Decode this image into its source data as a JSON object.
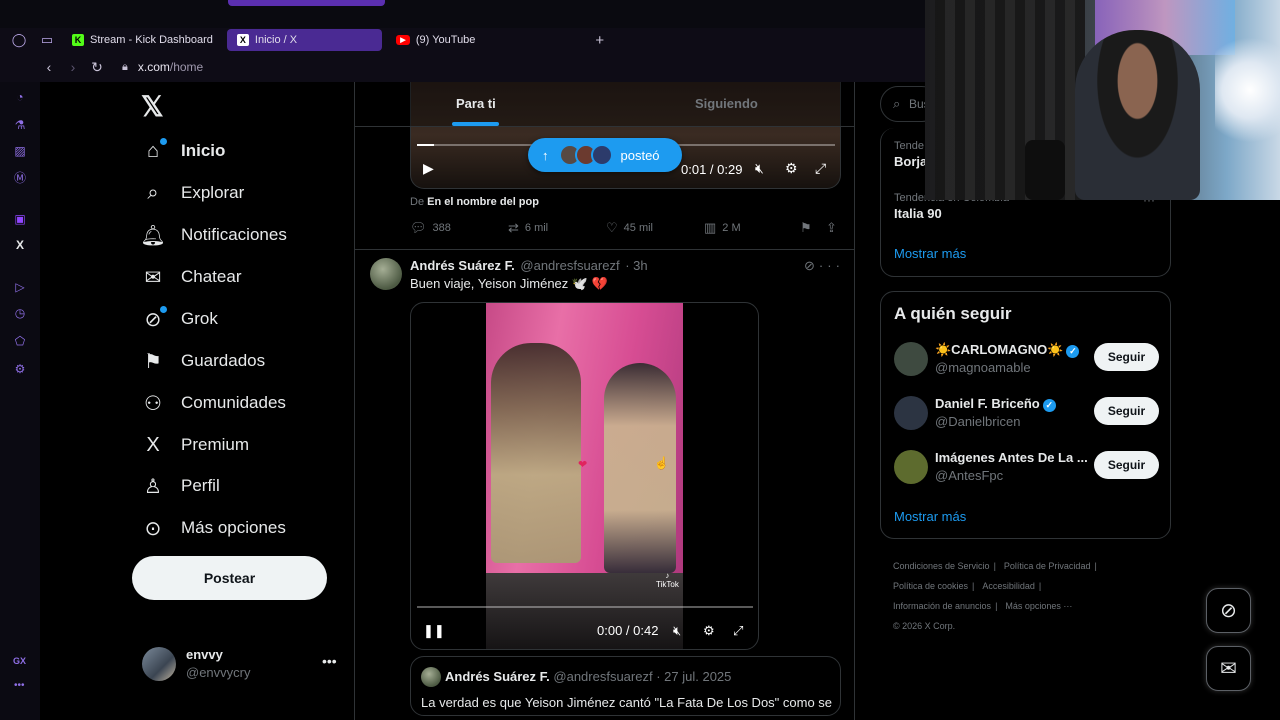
{
  "browser": {
    "tabs": [
      {
        "label": "Stream - Kick Dashboard",
        "icon": "kick-icon",
        "active": false
      },
      {
        "label": "Inicio / X",
        "icon": "x-icon",
        "active": true
      },
      {
        "label": "(9) YouTube",
        "icon": "youtube-icon",
        "active": false
      }
    ],
    "url_host": "x.com",
    "url_path": "/home",
    "gx_label": "GX",
    "gx_dots": "•••"
  },
  "nav": {
    "logo": "𝕏",
    "items": [
      {
        "label": "Inicio",
        "icon": "home-icon"
      },
      {
        "label": "Explorar",
        "icon": "search-icon"
      },
      {
        "label": "Notificaciones",
        "icon": "bell-icon"
      },
      {
        "label": "Chatear",
        "icon": "envelope-icon"
      },
      {
        "label": "Grok",
        "icon": "grok-icon"
      },
      {
        "label": "Guardados",
        "icon": "bookmark-icon"
      },
      {
        "label": "Comunidades",
        "icon": "people-icon"
      },
      {
        "label": "Premium",
        "icon": "x-premium-icon"
      },
      {
        "label": "Perfil",
        "icon": "person-icon"
      },
      {
        "label": "Más opciones",
        "icon": "more-circle-icon"
      }
    ],
    "post_button": "Postear",
    "account": {
      "name": "envvy",
      "handle": "@envvycry"
    }
  },
  "timeline": {
    "tabs": [
      "Para ti",
      "Siguiendo"
    ],
    "posted_pill": "posteó",
    "prev_post": {
      "video_time": "0:01 / 0:29",
      "from_prefix": "De",
      "from_source": "En el nombre del pop",
      "replies": "388",
      "reposts": "6 mil",
      "likes": "45 mil",
      "views": "2 M",
      "video_progress": 0.04
    },
    "post": {
      "name": "Andrés Suárez F.",
      "handle": "@andresfsuarezf",
      "time": "· 3h",
      "text": "Buen viaje, Yeison Jiménez 🕊️",
      "heart": "💔",
      "video_time": "0:00 / 0:42",
      "tiktok_label": "TikTok",
      "video_progress": 0.0,
      "quote": {
        "name": "Andrés Suárez F.",
        "handle": "@andresfsuarezf",
        "date": "· 27 jul. 2025",
        "text": "La verdad es que Yeison Jiménez cantó \"La Fata De Los Dos\" como se"
      }
    }
  },
  "right": {
    "search_placeholder": "Bus",
    "trends": [
      {
        "context": "Tende",
        "title": "Borja"
      },
      {
        "context": "Tendencia en Colombia",
        "title": "Italia 90"
      }
    ],
    "trends_more": "Mostrar más",
    "follow": {
      "title": "A quién seguir",
      "users": [
        {
          "name": "☀️CARLOMAGNO☀️",
          "handle": "@magnoamable",
          "verified": true,
          "button": "Seguir",
          "color": "#3e4a40"
        },
        {
          "name": "Daniel F. Briceño",
          "handle": "@Danielbricen",
          "verified": true,
          "button": "Seguir",
          "color": "#2c3442"
        },
        {
          "name": "Imágenes Antes De La ...",
          "handle": "@AntesFpc",
          "verified": false,
          "button": "Seguir",
          "color": "#5d6b2e"
        }
      ],
      "more": "Mostrar más"
    },
    "footer": {
      "links": [
        "Condiciones de Servicio",
        "Política de Privacidad",
        "Política de cookies",
        "Accesibilidad",
        "Información de anuncios",
        "Más opciones ···"
      ],
      "copyright": "© 2026 X Corp."
    }
  }
}
